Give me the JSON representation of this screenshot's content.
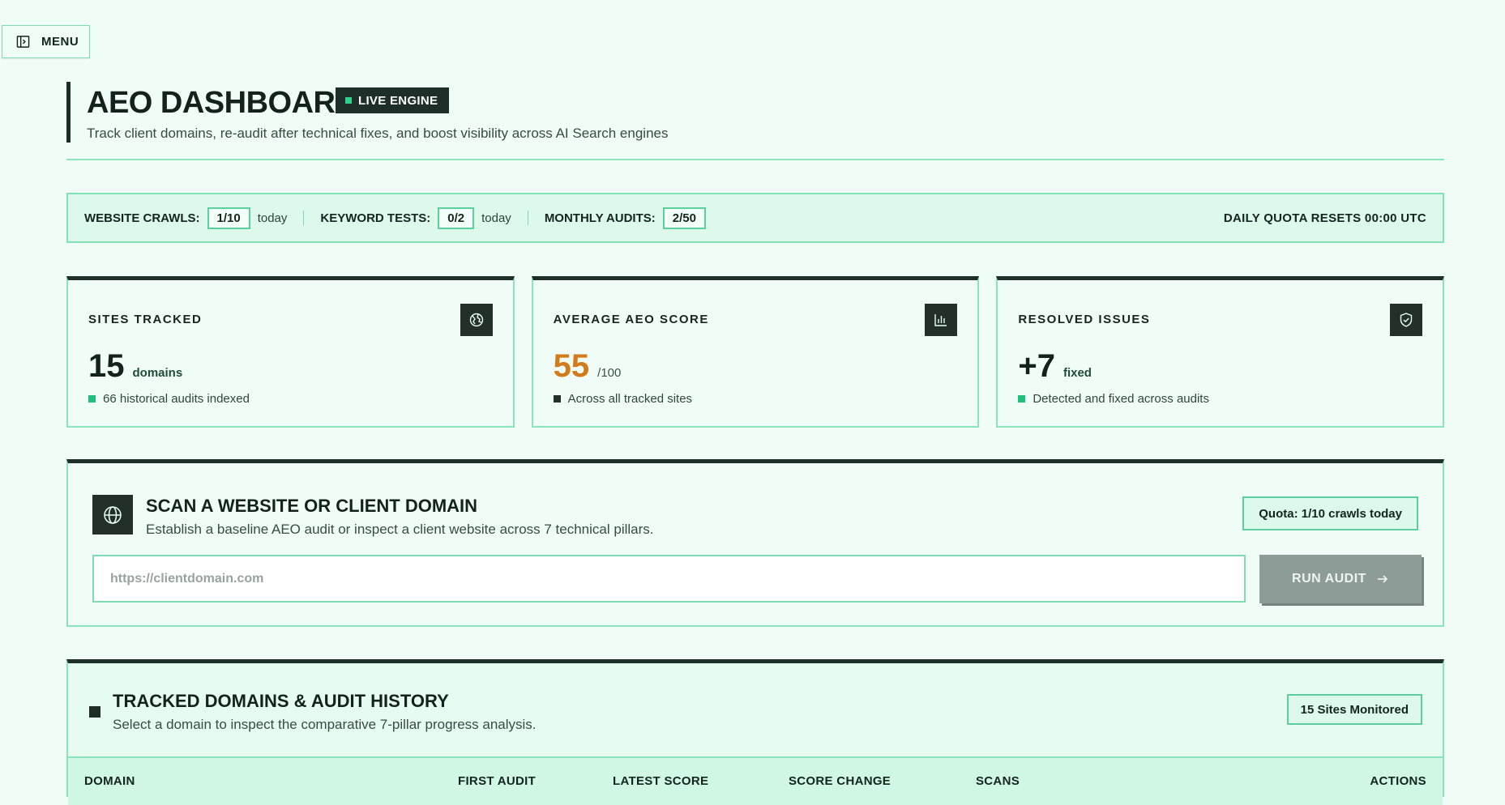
{
  "menu": {
    "label": "MENU"
  },
  "header": {
    "title": "AEO DASHBOARD",
    "badge": "LIVE ENGINE",
    "subtitle": "Track client domains, re-audit after technical fixes, and boost visibility across AI Search engines"
  },
  "quota": {
    "items": [
      {
        "label": "WEBSITE CRAWLS:",
        "value": "1/10",
        "suffix": "today"
      },
      {
        "label": "KEYWORD TESTS:",
        "value": "0/2",
        "suffix": "today"
      },
      {
        "label": "MONTHLY AUDITS:",
        "value": "2/50"
      }
    ],
    "reset": "DAILY QUOTA RESETS 00:00 UTC"
  },
  "stats": [
    {
      "label": "SITES TRACKED",
      "value": "15",
      "unit": "domains",
      "note": "66 historical audits indexed",
      "icon": "globe-grid-icon"
    },
    {
      "label": "AVERAGE AEO SCORE",
      "value": "55",
      "unit": "/100",
      "note": "Across all tracked sites",
      "icon": "bar-chart-icon"
    },
    {
      "label": "RESOLVED ISSUES",
      "value": "+7",
      "unit": "fixed",
      "note": "Detected and fixed across audits",
      "icon": "shield-check-icon"
    }
  ],
  "scan": {
    "title": "SCAN A WEBSITE OR CLIENT DOMAIN",
    "description": "Establish a baseline AEO audit or inspect a client website across 7 technical pillars.",
    "quota_label": "Quota: 1/10 crawls today",
    "input_placeholder": "https://clientdomain.com",
    "run_label": "RUN AUDIT"
  },
  "tracked": {
    "title": "TRACKED DOMAINS & AUDIT HISTORY",
    "description": "Select a domain to inspect the comparative 7-pillar progress analysis.",
    "badge": "15 Sites Monitored",
    "columns": [
      "DOMAIN",
      "FIRST AUDIT",
      "LATEST SCORE",
      "SCORE CHANGE",
      "SCANS",
      "ACTIONS"
    ]
  },
  "colors": {
    "background": "#f0fcf6",
    "accent": "#1fbf7c",
    "dark": "#1f2f29",
    "score_orange": "#d37a1a",
    "border": "#8ae3bc"
  }
}
